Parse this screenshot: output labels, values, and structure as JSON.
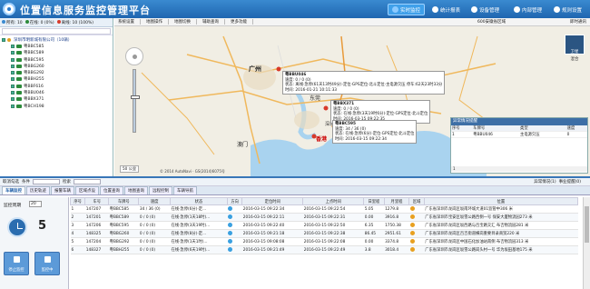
{
  "app": {
    "title": "位置信息服务监控管理平台"
  },
  "nav": [
    {
      "label": "实时监控",
      "active": true
    },
    {
      "label": "统计报表"
    },
    {
      "label": "设备管理"
    },
    {
      "label": "内部管理"
    },
    {
      "label": "规则设置"
    }
  ],
  "sidebar": {
    "counts": {
      "total": "所有: 10",
      "online": "在线: 0 (0%)",
      "offline": "离线: 10 (100%)"
    },
    "colors": {
      "online": "#2c8a3a",
      "offline": "#d83a2a",
      "total": "#3a8ad0"
    },
    "company": "深圳市明新城有限公司（10辆）",
    "vehicles": [
      "粤BBC585",
      "粤BBC589",
      "粤BBC595",
      "粤BBG260",
      "粤BBG292",
      "粤BBH255",
      "粤BBF616",
      "粤BBU046",
      "粤BBX371",
      "粤BCH198"
    ]
  },
  "map": {
    "toolbar": [
      "系统设置",
      "地图操作",
      "地图切换",
      "辅助查询",
      "更多功能"
    ],
    "right": "即时通讯",
    "center_label": "600安徽省区域",
    "satellite": "卫星",
    "layer": "混合",
    "scale": "50 公里",
    "copyright": "© 2014 AutoNavi · GS(2014)6075号",
    "cities": [
      "广州",
      "东莞",
      "深圳",
      "澳门",
      "香港"
    ],
    "popups": [
      {
        "plate": "粤BBU046",
        "speed": "速度: 0 / 0 (0)",
        "status": "状态: 离线·急停(61天13时49分)·定位·GPS定位·北斗定位·主电源欠压 停车:62天23时33分",
        "time": "时间: 2016-01-21 10:11:33"
      },
      {
        "plate": "粤BBX371",
        "speed": "速度: 0 / 0 (0)",
        "status": "状态: 在线·急停(3天19时6分)·定位·GPS定位·北斗定位",
        "time": "时间: 2016-03-15 09:22:35"
      },
      {
        "plate": "粤BBC595",
        "speed": "速度: 34 / 36 (0)",
        "status": "状态: 在线·急停(6分)·定位·GPS定位·北斗定位",
        "time": "时间: 2016-03-15 09:22:34"
      }
    ]
  },
  "alarm": {
    "title": "异常情况提醒",
    "headers": [
      "序号",
      "车牌号",
      "类型",
      "速度"
    ],
    "rows": [
      [
        "1",
        "粤BBU046",
        "主电源欠压",
        "0"
      ]
    ],
    "pager": "1"
  },
  "filter": {
    "label1": "取消勾选",
    "label2": "条件",
    "label3": "检索",
    "right1": "异常情况(1)",
    "right2": "事业提醒(0)"
  },
  "tabs": [
    "车辆监控",
    "历史轨迹",
    "报警车辆",
    "区域点设",
    "位置查询",
    "地图查询",
    "远程控制",
    "车辆导航"
  ],
  "monitor": {
    "cycle_label": "监控周期",
    "cycle": "20",
    "countdown": "5",
    "stop": "停止监控",
    "pause": "监控中"
  },
  "grid": {
    "headers": [
      "序号",
      "车号",
      "车牌号",
      "速度",
      "状态",
      "方向",
      "定位时间",
      "上点时间",
      "日里程",
      "月里程",
      "区域",
      "位置"
    ],
    "rows": [
      [
        "1",
        "147207",
        "粤BBC585",
        "34 / 36 (0)",
        "在线·急停(6分)·定...",
        "",
        "2016-03-15 09:22:34",
        "2016-03-15 09:22:54",
        "5.05",
        "1279.8",
        "",
        "广东省深圳市龙岗区坂南环城大道01监管中306 米"
      ],
      [
        "2",
        "147201",
        "粤BBC589",
        "0 / 0 (0)",
        "在线·急停(1天18时)...",
        "",
        "2016-03-15 09:22:11",
        "2016-03-15 09:22:31",
        "0.00",
        "3916.8",
        "",
        "广东省深圳市宝安区坂雪公路西侧一号 保安大厦物流园273 米"
      ],
      [
        "3",
        "147206",
        "粤BBC595",
        "0 / 0 (0)",
        "在线·急停(3天19时)...",
        "",
        "2016-03-15 09:22:40",
        "2016-03-15 09:22:50",
        "6.35",
        "1750.38",
        "",
        "广东省深圳市龙岗区坂西路与百宝路交汇 布吉物流园281 米"
      ],
      [
        "4",
        "148325",
        "粤BBG260",
        "0 / 0 (0)",
        "在线·急停(8分)·定...",
        "",
        "2016-03-15 09:21:18",
        "2016-03-15 09:22:38",
        "86.45",
        "2951.61",
        "",
        "广东省深圳市龙岗区百吉街道横岗重要目录商贸220 米"
      ],
      [
        "5",
        "147204",
        "粤BBG292",
        "0 / 0 (0)",
        "在线·急停(1天1时)...",
        "",
        "2016-03-15 09:08:08",
        "2016-03-15 09:22:08",
        "0.00",
        "3374.8",
        "",
        "广东省深圳市龙岗区中国石化加油站南侧 布吉物流园313 米"
      ],
      [
        "6",
        "148327",
        "粤BBH255",
        "0 / 0 (0)",
        "在线·急停(6天19时)...",
        "",
        "2016-03-15 09:21:49",
        "2016-03-15 09:22:49",
        "3.8",
        "3018.4",
        "",
        "广东省深圳市龙岗区坂雪公路岗头村一号 华为坂田基地175 米"
      ]
    ]
  }
}
